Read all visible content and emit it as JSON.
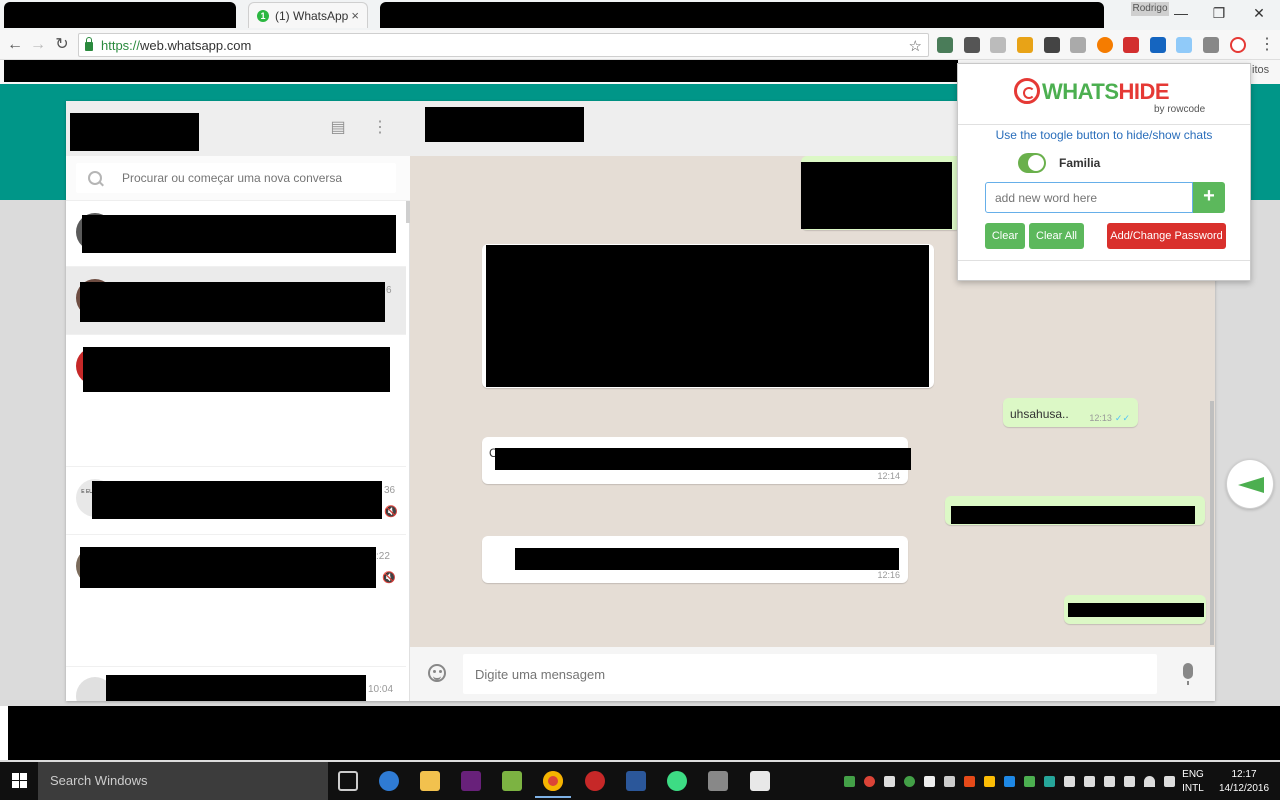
{
  "browser": {
    "active_tab_badge": "1",
    "active_tab_title": "(1) WhatsApp",
    "tab_close_glyph": "×",
    "profile_name": "Rodrigo",
    "window_controls": {
      "minimize": "—",
      "restore": "❐",
      "close": "✕"
    },
    "url_scheme": "https://",
    "url_host": "web.whatsapp.com",
    "bookmarks_overflow_label": "itos"
  },
  "whatsapp": {
    "accent_color": "#009688",
    "search_placeholder": "Procurar ou começar uma nova conversa",
    "chat_list": [
      {
        "time": "",
        "selected": false,
        "muted": false
      },
      {
        "time": "6",
        "selected": true,
        "muted": false
      },
      {
        "time": "",
        "selected": false,
        "muted": false
      },
      {
        "time": "36",
        "selected": false,
        "muted": true,
        "avatar_text": "E EU PROC"
      },
      {
        "time": ":22",
        "selected": false,
        "muted": true
      },
      {
        "time": "10:04",
        "selected": false,
        "muted": false
      }
    ],
    "messages": [
      {
        "direction": "out",
        "text": "uhsahusa..",
        "time": "12:13",
        "read": true
      },
      {
        "direction": "in",
        "text": "C",
        "time": "12:14"
      },
      {
        "direction": "out",
        "text": "",
        "time": "",
        "read": true
      },
      {
        "direction": "in",
        "text": "",
        "time": "12:16"
      }
    ],
    "composer_placeholder": "Digite uma mensagem"
  },
  "extension_popup": {
    "logo_part_1": "WHATS",
    "logo_part_2": "HIDE",
    "logo_byline": "by rowcode",
    "instructions": "Use the toogle button to hide/show chats",
    "toggle_label": "Familia",
    "toggle_on": true,
    "word_input_placeholder": "add new word here",
    "add_button_glyph": "+",
    "clear_label": "Clear",
    "clear_all_label": "Clear All",
    "password_label": "Add/Change Password"
  },
  "taskbar": {
    "search_placeholder": "Search Windows",
    "language_line_1": "ENG",
    "language_line_2": "INTL",
    "clock_time": "12:17",
    "clock_date": "14/12/2016"
  }
}
